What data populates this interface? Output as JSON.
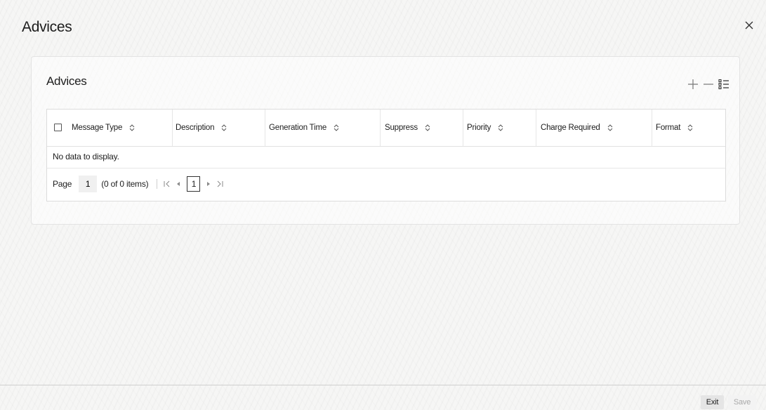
{
  "window": {
    "title": "Advices",
    "close_label": "X"
  },
  "panel": {
    "title": "Advices"
  },
  "grid": {
    "columns": [
      {
        "label": "Message Type"
      },
      {
        "label": "Description"
      },
      {
        "label": "Generation Time"
      },
      {
        "label": "Suppress"
      },
      {
        "label": "Priority"
      },
      {
        "label": "Charge Required"
      },
      {
        "label": "Format"
      }
    ],
    "empty_message": "No data to display.",
    "pagination": {
      "page_label": "Page",
      "page_value": "1",
      "count_text": "(0 of 0 items)",
      "current_page": "1"
    }
  },
  "footer": {
    "exit_label": "Exit",
    "save_label": "Save"
  },
  "icons": {
    "close": "close-icon",
    "add": "plus-icon",
    "delete": "minus-icon",
    "single_view": "list-view-icon",
    "sort": "sort-icon",
    "first_page": "first-page-icon",
    "prev_page": "prev-page-icon",
    "next_page": "next-page-icon",
    "last_page": "last-page-icon"
  }
}
